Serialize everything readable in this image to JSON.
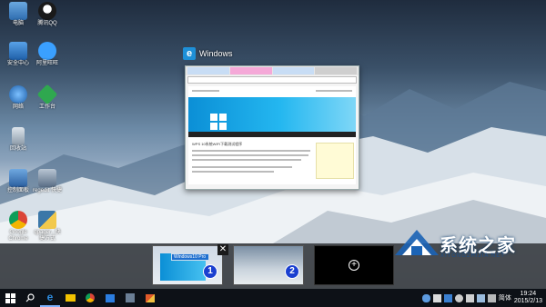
{
  "desktop": {
    "icons": [
      {
        "name": "desktop-icon-computer",
        "label": "电脑",
        "icon": "computer-icon",
        "color": "#4a88c8"
      },
      {
        "name": "desktop-icon-qq",
        "label": "腾讯QQ",
        "icon": "qq-penguin-icon",
        "color": "#1a1a1a"
      },
      {
        "name": "desktop-icon-control",
        "label": "安全中心",
        "icon": "shield-icon",
        "color": "#2f7fd1"
      },
      {
        "name": "desktop-icon-aliwang",
        "label": "阿里旺旺",
        "icon": "aliwangwang-icon",
        "color": "#3aa0ff"
      },
      {
        "name": "desktop-icon-network",
        "label": "网络",
        "icon": "network-globe-icon",
        "color": "#2c72c0"
      },
      {
        "name": "desktop-icon-app",
        "label": "工作台",
        "icon": "diamond-app-icon",
        "color": "#2fa84f"
      },
      {
        "name": "desktop-icon-recycle",
        "label": "回收站",
        "icon": "recycle-bin-icon",
        "color": "#a9b6c2"
      },
      {
        "name": "desktop-icon-controlpanel",
        "label": "控制面板",
        "icon": "control-panel-icon",
        "color": "#3f7bc9"
      },
      {
        "name": "desktop-icon-regedit",
        "label": "regedit 快捷",
        "icon": "regedit-icon",
        "color": "#5a6e86"
      },
      {
        "name": "desktop-icon-chrome",
        "label": "Google Chrome",
        "icon": "chrome-icon",
        "color": "#dd3b2a"
      },
      {
        "name": "desktop-icon-python",
        "label": "qpager...快捷方式",
        "icon": "python-icon",
        "color": "#3b77a8"
      }
    ]
  },
  "preview": {
    "app_label": "Windows",
    "page_heading": "WPS 10系统WIFI下载测试程序"
  },
  "taskview": {
    "thumb1_label": "Windows10 Pro",
    "badge1": "1",
    "badge2": "2",
    "close_glyph": "✕",
    "add_glyph": "+"
  },
  "watermark": {
    "title": "系统之家",
    "subtitle": "XITONGZHIJIA.NET"
  },
  "taskbar": {
    "lang": "简体",
    "time": "19:24",
    "date": "2015/2/13",
    "apps": [
      "windows-start-icon",
      "search-icon",
      "edge-icon",
      "file-explorer-icon",
      "chrome-icon",
      "store-icon",
      "settings-icon",
      "photos-icon"
    ]
  }
}
